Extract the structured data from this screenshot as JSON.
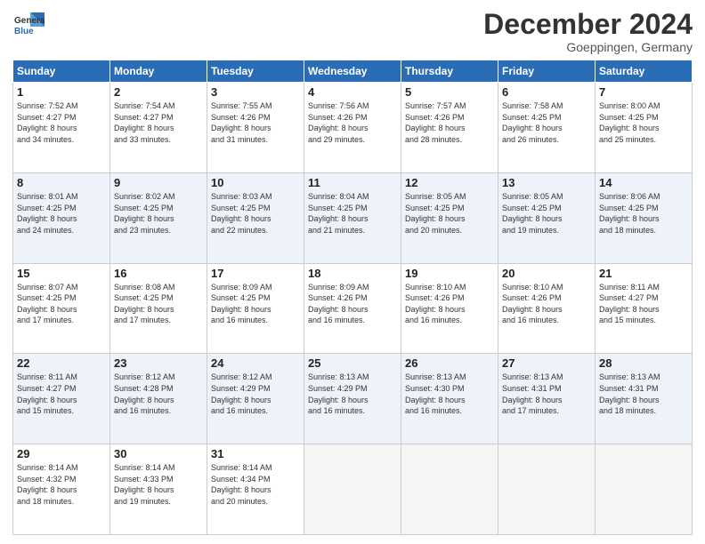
{
  "header": {
    "logo_line1": "General",
    "logo_line2": "Blue",
    "month": "December 2024",
    "location": "Goeppingen, Germany"
  },
  "days_of_week": [
    "Sunday",
    "Monday",
    "Tuesday",
    "Wednesday",
    "Thursday",
    "Friday",
    "Saturday"
  ],
  "weeks": [
    [
      {
        "day": "1",
        "sunrise": "Sunrise: 7:52 AM",
        "sunset": "Sunset: 4:27 PM",
        "daylight": "Daylight: 8 hours",
        "and": "and 34 minutes."
      },
      {
        "day": "2",
        "sunrise": "Sunrise: 7:54 AM",
        "sunset": "Sunset: 4:27 PM",
        "daylight": "Daylight: 8 hours",
        "and": "and 33 minutes."
      },
      {
        "day": "3",
        "sunrise": "Sunrise: 7:55 AM",
        "sunset": "Sunset: 4:26 PM",
        "daylight": "Daylight: 8 hours",
        "and": "and 31 minutes."
      },
      {
        "day": "4",
        "sunrise": "Sunrise: 7:56 AM",
        "sunset": "Sunset: 4:26 PM",
        "daylight": "Daylight: 8 hours",
        "and": "and 29 minutes."
      },
      {
        "day": "5",
        "sunrise": "Sunrise: 7:57 AM",
        "sunset": "Sunset: 4:26 PM",
        "daylight": "Daylight: 8 hours",
        "and": "and 28 minutes."
      },
      {
        "day": "6",
        "sunrise": "Sunrise: 7:58 AM",
        "sunset": "Sunset: 4:25 PM",
        "daylight": "Daylight: 8 hours",
        "and": "and 26 minutes."
      },
      {
        "day": "7",
        "sunrise": "Sunrise: 8:00 AM",
        "sunset": "Sunset: 4:25 PM",
        "daylight": "Daylight: 8 hours",
        "and": "and 25 minutes."
      }
    ],
    [
      {
        "day": "8",
        "sunrise": "Sunrise: 8:01 AM",
        "sunset": "Sunset: 4:25 PM",
        "daylight": "Daylight: 8 hours",
        "and": "and 24 minutes."
      },
      {
        "day": "9",
        "sunrise": "Sunrise: 8:02 AM",
        "sunset": "Sunset: 4:25 PM",
        "daylight": "Daylight: 8 hours",
        "and": "and 23 minutes."
      },
      {
        "day": "10",
        "sunrise": "Sunrise: 8:03 AM",
        "sunset": "Sunset: 4:25 PM",
        "daylight": "Daylight: 8 hours",
        "and": "and 22 minutes."
      },
      {
        "day": "11",
        "sunrise": "Sunrise: 8:04 AM",
        "sunset": "Sunset: 4:25 PM",
        "daylight": "Daylight: 8 hours",
        "and": "and 21 minutes."
      },
      {
        "day": "12",
        "sunrise": "Sunrise: 8:05 AM",
        "sunset": "Sunset: 4:25 PM",
        "daylight": "Daylight: 8 hours",
        "and": "and 20 minutes."
      },
      {
        "day": "13",
        "sunrise": "Sunrise: 8:05 AM",
        "sunset": "Sunset: 4:25 PM",
        "daylight": "Daylight: 8 hours",
        "and": "and 19 minutes."
      },
      {
        "day": "14",
        "sunrise": "Sunrise: 8:06 AM",
        "sunset": "Sunset: 4:25 PM",
        "daylight": "Daylight: 8 hours",
        "and": "and 18 minutes."
      }
    ],
    [
      {
        "day": "15",
        "sunrise": "Sunrise: 8:07 AM",
        "sunset": "Sunset: 4:25 PM",
        "daylight": "Daylight: 8 hours",
        "and": "and 17 minutes."
      },
      {
        "day": "16",
        "sunrise": "Sunrise: 8:08 AM",
        "sunset": "Sunset: 4:25 PM",
        "daylight": "Daylight: 8 hours",
        "and": "and 17 minutes."
      },
      {
        "day": "17",
        "sunrise": "Sunrise: 8:09 AM",
        "sunset": "Sunset: 4:25 PM",
        "daylight": "Daylight: 8 hours",
        "and": "and 16 minutes."
      },
      {
        "day": "18",
        "sunrise": "Sunrise: 8:09 AM",
        "sunset": "Sunset: 4:26 PM",
        "daylight": "Daylight: 8 hours",
        "and": "and 16 minutes."
      },
      {
        "day": "19",
        "sunrise": "Sunrise: 8:10 AM",
        "sunset": "Sunset: 4:26 PM",
        "daylight": "Daylight: 8 hours",
        "and": "and 16 minutes."
      },
      {
        "day": "20",
        "sunrise": "Sunrise: 8:10 AM",
        "sunset": "Sunset: 4:26 PM",
        "daylight": "Daylight: 8 hours",
        "and": "and 16 minutes."
      },
      {
        "day": "21",
        "sunrise": "Sunrise: 8:11 AM",
        "sunset": "Sunset: 4:27 PM",
        "daylight": "Daylight: 8 hours",
        "and": "and 15 minutes."
      }
    ],
    [
      {
        "day": "22",
        "sunrise": "Sunrise: 8:11 AM",
        "sunset": "Sunset: 4:27 PM",
        "daylight": "Daylight: 8 hours",
        "and": "and 15 minutes."
      },
      {
        "day": "23",
        "sunrise": "Sunrise: 8:12 AM",
        "sunset": "Sunset: 4:28 PM",
        "daylight": "Daylight: 8 hours",
        "and": "and 16 minutes."
      },
      {
        "day": "24",
        "sunrise": "Sunrise: 8:12 AM",
        "sunset": "Sunset: 4:29 PM",
        "daylight": "Daylight: 8 hours",
        "and": "and 16 minutes."
      },
      {
        "day": "25",
        "sunrise": "Sunrise: 8:13 AM",
        "sunset": "Sunset: 4:29 PM",
        "daylight": "Daylight: 8 hours",
        "and": "and 16 minutes."
      },
      {
        "day": "26",
        "sunrise": "Sunrise: 8:13 AM",
        "sunset": "Sunset: 4:30 PM",
        "daylight": "Daylight: 8 hours",
        "and": "and 16 minutes."
      },
      {
        "day": "27",
        "sunrise": "Sunrise: 8:13 AM",
        "sunset": "Sunset: 4:31 PM",
        "daylight": "Daylight: 8 hours",
        "and": "and 17 minutes."
      },
      {
        "day": "28",
        "sunrise": "Sunrise: 8:13 AM",
        "sunset": "Sunset: 4:31 PM",
        "daylight": "Daylight: 8 hours",
        "and": "and 18 minutes."
      }
    ],
    [
      {
        "day": "29",
        "sunrise": "Sunrise: 8:14 AM",
        "sunset": "Sunset: 4:32 PM",
        "daylight": "Daylight: 8 hours",
        "and": "and 18 minutes."
      },
      {
        "day": "30",
        "sunrise": "Sunrise: 8:14 AM",
        "sunset": "Sunset: 4:33 PM",
        "daylight": "Daylight: 8 hours",
        "and": "and 19 minutes."
      },
      {
        "day": "31",
        "sunrise": "Sunrise: 8:14 AM",
        "sunset": "Sunset: 4:34 PM",
        "daylight": "Daylight: 8 hours",
        "and": "and 20 minutes."
      },
      null,
      null,
      null,
      null
    ]
  ]
}
